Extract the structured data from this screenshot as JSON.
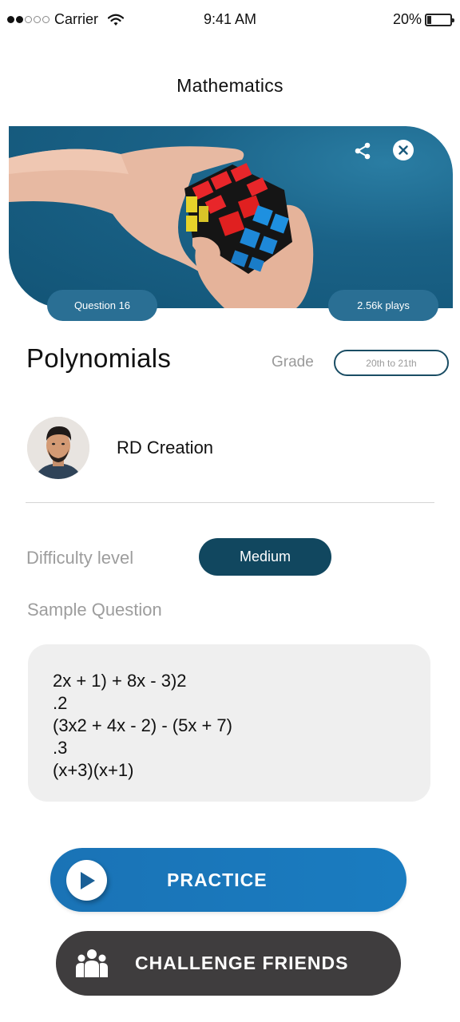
{
  "status_bar": {
    "signal_strength": "2 of 5",
    "carrier": "Carrier",
    "time": "9:41 AM",
    "battery_percent": "20%",
    "battery_level": 0.2
  },
  "header": {
    "title": "Mathematics"
  },
  "hero": {
    "image_description": "Hands holding a Rubik's cube on a teal background",
    "share_icon": "share-icon",
    "close_icon": "close-icon",
    "question_badge": "Question 16",
    "plays_badge": "2.56k plays"
  },
  "topic": {
    "title": "Polynomials",
    "grade_label": "Grade",
    "grade_value": "20th to 21th"
  },
  "author": {
    "name": "RD Creation",
    "avatar": "author-avatar"
  },
  "difficulty": {
    "label": "Difficulty level",
    "value": "Medium"
  },
  "sample": {
    "label": "Sample Question",
    "lines": [
      "2x + 1) + 8x - 3)2",
      ".2",
      "(3x2 + 4x - 2) - (5x + 7)",
      ".3",
      "(x+3)(x+1)"
    ]
  },
  "actions": {
    "practice_label": "PRACTICE",
    "practice_icon": "play-icon",
    "challenge_label": "CHALLENGE FRIENDS",
    "challenge_icon": "group-icon"
  },
  "colors": {
    "primary_dark": "#11475f",
    "badge_blue": "#2a6f94",
    "practice_blue": "#1a73b6",
    "challenge_dark": "#3f3d3e",
    "muted_text": "#9d9d9d"
  }
}
